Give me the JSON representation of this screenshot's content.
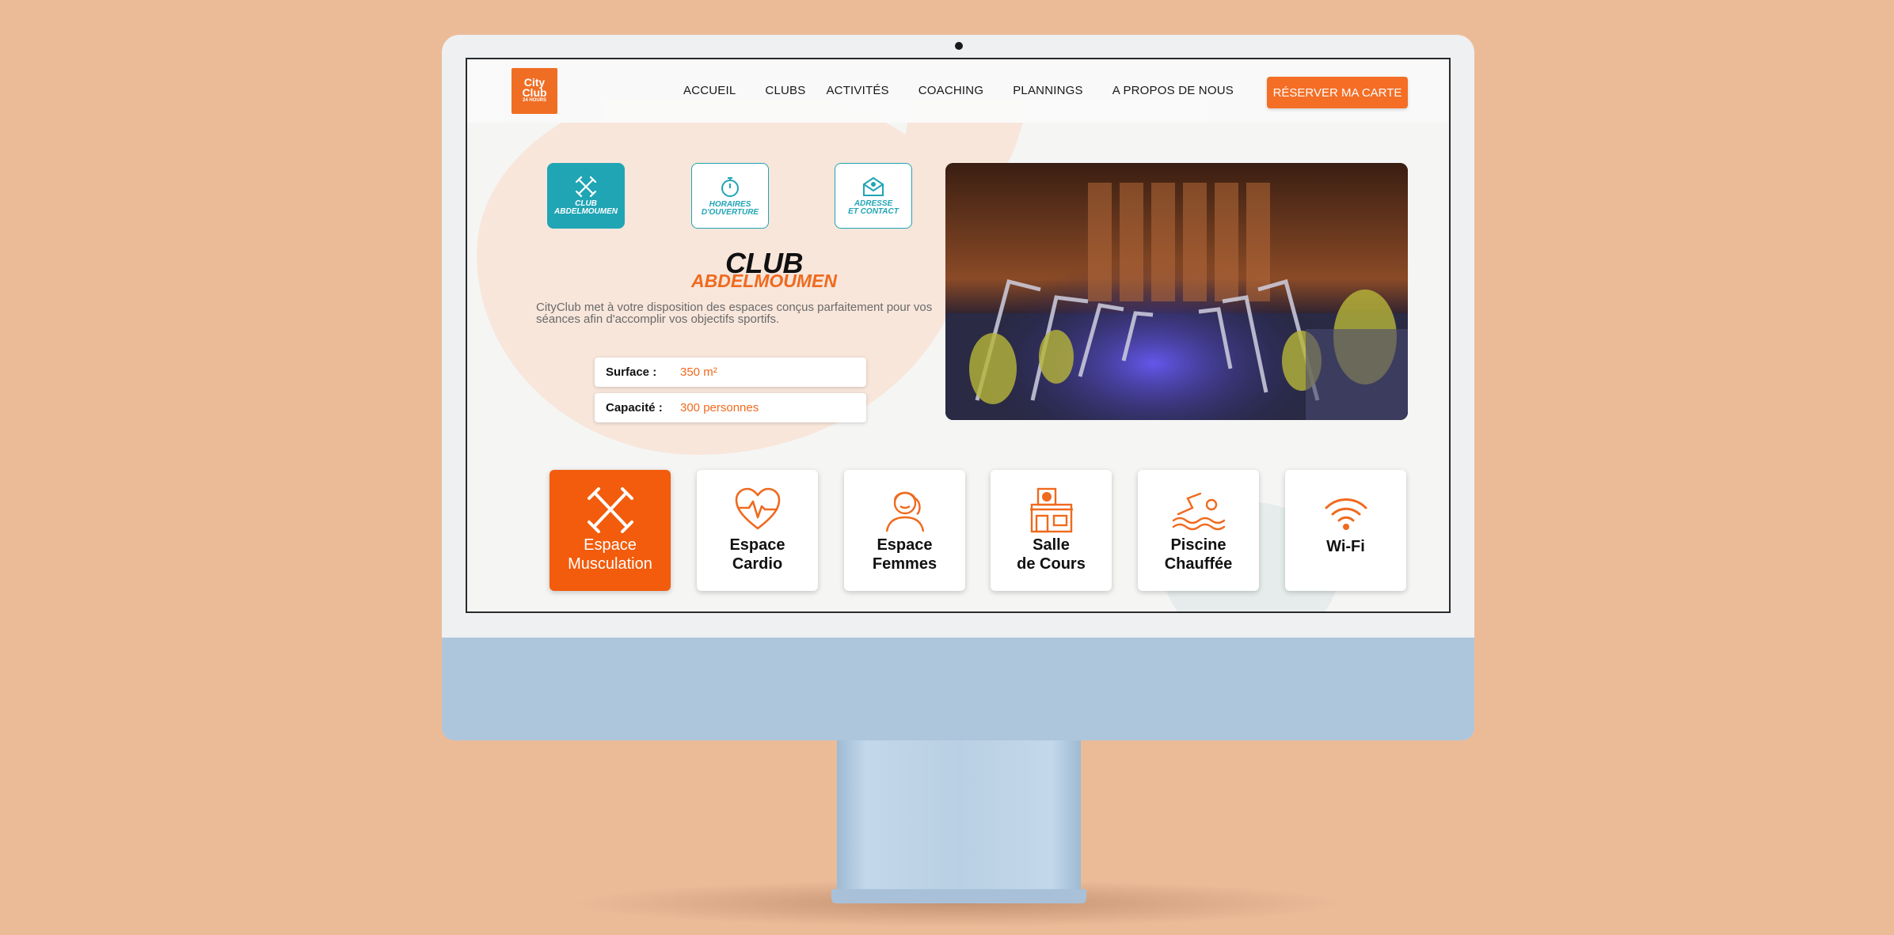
{
  "header": {
    "logo_line1": "City",
    "logo_line2": "Club",
    "logo_sub": "24 HOURS",
    "nav": [
      "ACCUEIL",
      "CLUBS",
      "ACTIVITÉS",
      "COACHING",
      "PLANNINGS",
      "A PROPOS DE NOUS"
    ],
    "reserve_label": "RÉSERVER MA CARTE"
  },
  "tabs": [
    {
      "line1": "CLUB",
      "line2": "ABDELMOUMEN",
      "icon": "dumbbells-cross-icon"
    },
    {
      "line1": "HORAIRES",
      "line2": "D'OUVERTURE",
      "icon": "stopwatch-icon"
    },
    {
      "line1": "ADRESSE",
      "line2": "ET CONTACT",
      "icon": "envelope-location-icon"
    }
  ],
  "club": {
    "title": "CLUB",
    "name": "ABDELMOUMEN",
    "description": "CityClub met à votre disposition des espaces conçus parfaitement pour vos séances afin d'accomplir vos objectifs sportifs."
  },
  "info": {
    "surface_label": "Surface :",
    "surface_value": "350 m²",
    "capacity_label": "Capacité :",
    "capacity_value": "300 personnes"
  },
  "features": [
    {
      "line1": "Espace",
      "line2": "Musculation",
      "icon": "dumbbells-icon"
    },
    {
      "line1": "Espace",
      "line2": "Cardio",
      "icon": "heart-pulse-icon"
    },
    {
      "line1": "Espace",
      "line2": "Femmes",
      "icon": "woman-icon"
    },
    {
      "line1": "Salle",
      "line2": "de Cours",
      "icon": "building-icon"
    },
    {
      "line1": "Piscine",
      "line2": "Chauffée",
      "icon": "swimmer-icon"
    },
    {
      "line1": "Wi-Fi",
      "line2": "",
      "icon": "wifi-icon"
    }
  ],
  "colors": {
    "brand_orange": "#F25C0C",
    "teal": "#20A5B5",
    "background": "#EBBB98"
  }
}
